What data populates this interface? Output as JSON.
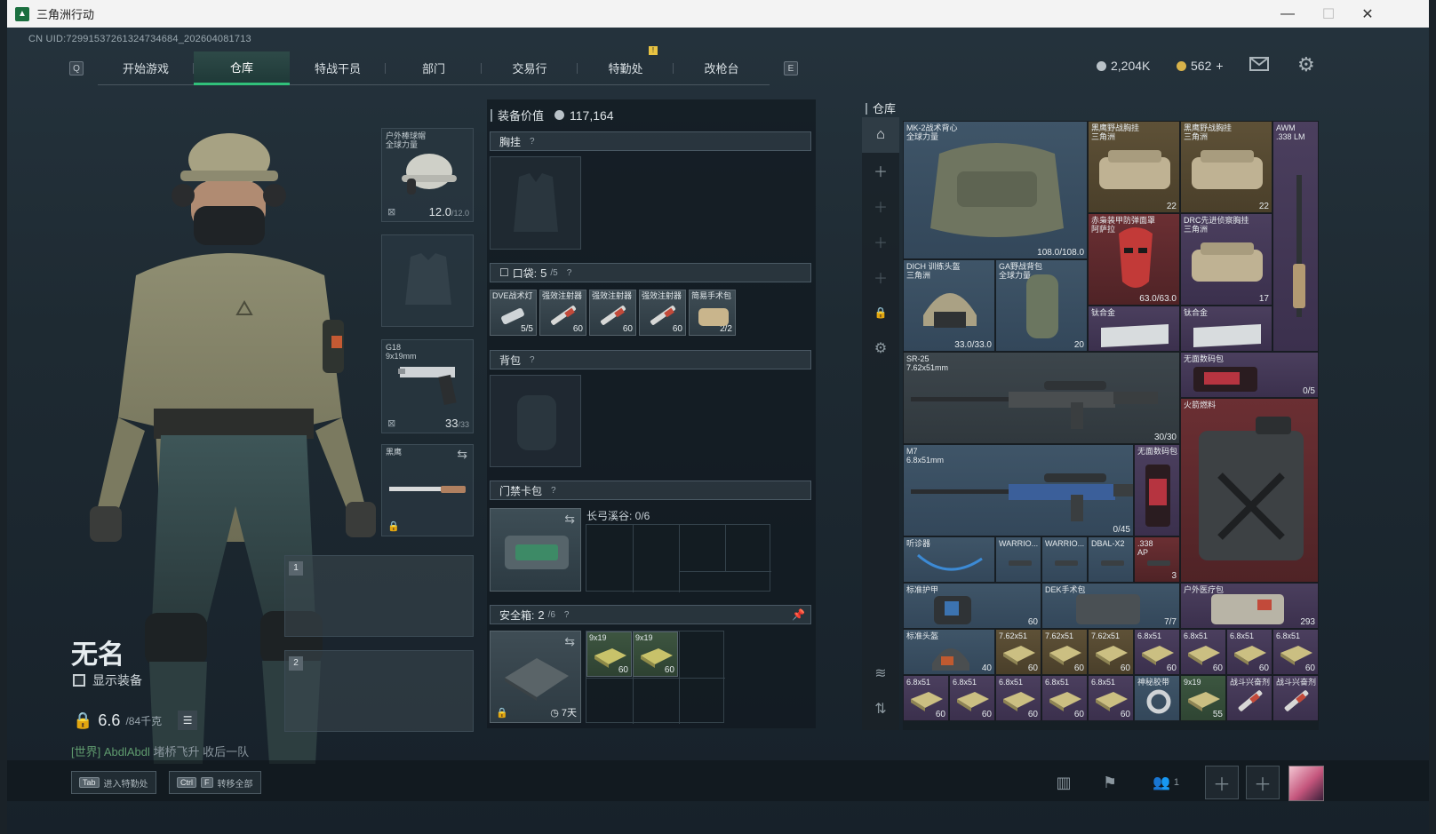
{
  "window": {
    "title": "三角洲行动"
  },
  "uid": "CN UID:7299153726132473468­4_202604081713",
  "nav": {
    "key_left": "Q",
    "key_right": "E",
    "tabs": [
      "开始游戏",
      "仓库",
      "特战干员",
      "部门",
      "交易行",
      "特勤处",
      "改枪台"
    ],
    "selected": "仓库"
  },
  "currency": {
    "silver": "2,204K",
    "gold": "562"
  },
  "player": {
    "name": "无名",
    "show_gear_label": "显示装备",
    "weight": "6.6",
    "weight_max": "/84千克",
    "chat_channel": "[世界] AbdlAbdl",
    "chat_text": "堵桥飞升 收后一队"
  },
  "loadout": {
    "helmet": {
      "label": "户外棒球帽",
      "sub": "全球力量",
      "value": "12.0",
      "max": "/12.0"
    },
    "pistol": {
      "label": "G18",
      "sub": "9x19mm",
      "value": "33",
      "max": "/33"
    },
    "melee": {
      "label": "黑鹰"
    },
    "slot1": "1",
    "slot2": "2"
  },
  "equipment": {
    "value_label": "装备价值",
    "value": "117,164",
    "chest": "胸挂",
    "pockets_label": "口袋:",
    "pockets_count": "5",
    "pockets_max": "/5",
    "pocket_items": [
      {
        "label": "DVE战术灯",
        "cnt": "5/5"
      },
      {
        "label": "强效注射器",
        "cnt": "60"
      },
      {
        "label": "强效注射器",
        "cnt": "60"
      },
      {
        "label": "强效注射器",
        "cnt": "60"
      },
      {
        "label": "简易手术包",
        "cnt": "2/2"
      }
    ],
    "backpack": "背包",
    "keycard": "门禁卡包",
    "keycard_map": "长弓溪谷: 0/6",
    "safebox_label": "安全箱:",
    "safebox_count": "2",
    "safebox_max": "/6",
    "safebox_time": "7天",
    "safebox_items": [
      {
        "label": "9x19",
        "cnt": "60"
      },
      {
        "label": "9x19",
        "cnt": "60"
      }
    ]
  },
  "warehouse": {
    "title": "仓库",
    "items": {
      "vest": {
        "label": "MK-2战术背心",
        "sub": "全球力量",
        "cnt": "108.0/108.0"
      },
      "rig1": {
        "label": "黑鹰野战胸挂",
        "sub": "三角洲",
        "cnt": "22"
      },
      "rig2": {
        "label": "黑鹰野战胸挂",
        "sub": "三角洲",
        "cnt": "22"
      },
      "awm": {
        "label": "AWM",
        "sub": ".338 LM"
      },
      "mask": {
        "label": "赤枭装甲防弹面罩",
        "sub": "阿萨拉",
        "cnt": "63.0/63.0"
      },
      "drc": {
        "label": "DRC先进侦察胸挂",
        "sub": "三角洲",
        "cnt": "17"
      },
      "dich": {
        "label": "DICH 训练头盔",
        "sub": "三角洲",
        "cnt": "33.0/33.0"
      },
      "ga": {
        "label": "GA野战背包",
        "sub": "全球力量",
        "cnt": "20"
      },
      "ingot1": {
        "label": "钛合金"
      },
      "ingot2": {
        "label": "钛合金"
      },
      "sr25": {
        "label": "SR-25",
        "sub": "7.62x51mm",
        "cnt": "30/30"
      },
      "drive1": {
        "label": "无面数码包",
        "cnt": "0/5"
      },
      "fuel": {
        "label": "火箭燃料"
      },
      "m7": {
        "label": "M7",
        "sub": "6.8x51mm",
        "cnt": "0/45"
      },
      "drive2": {
        "label": "无面数码包"
      },
      "steth": {
        "label": "听诊器"
      },
      "w1": {
        "label": "WARRIO..."
      },
      "w2": {
        "label": "WARRIO..."
      },
      "dbal": {
        "label": "DBAL-X2"
      },
      "ap338": {
        "label": ".338",
        "sub": "AP",
        "cnt": "3"
      },
      "armor": {
        "label": "标准护甲",
        "cnt": "60"
      },
      "dek": {
        "label": "DEK手术包",
        "cnt": "7/7"
      },
      "medkit": {
        "label": "户外医疗包",
        "cnt": "293"
      },
      "helm2": {
        "label": "标准头盔",
        "cnt": "40"
      },
      "ammo_row1": [
        {
          "label": "7.62x51",
          "cnt": "60"
        },
        {
          "label": "7.62x51",
          "cnt": "60"
        },
        {
          "label": "7.62x51",
          "cnt": "60"
        },
        {
          "label": "6.8x51",
          "cnt": "60"
        },
        {
          "label": "6.8x51",
          "cnt": "60"
        },
        {
          "label": "6.8x51",
          "cnt": "60"
        },
        {
          "label": "6.8x51",
          "cnt": "60"
        }
      ],
      "ammo_row2": [
        {
          "label": "6.8x51",
          "cnt": "60"
        },
        {
          "label": "6.8x51",
          "cnt": "60"
        },
        {
          "label": "6.8x51",
          "cnt": "60"
        },
        {
          "label": "6.8x51",
          "cnt": "60"
        },
        {
          "label": "6.8x51",
          "cnt": "60"
        },
        {
          "label": "神秘胶带",
          "cnt": ""
        },
        {
          "label": "9x19",
          "cnt": "55"
        },
        {
          "label": "战斗兴奋剂",
          "cnt": ""
        },
        {
          "label": "战斗兴奋剂",
          "cnt": ""
        }
      ],
      "bottom_label": "标准头盔"
    }
  },
  "bottom": {
    "tab_key": "Tab",
    "tab_label": "进入特勤处",
    "ctrl_key": "Ctrl",
    "f_key": "F",
    "transfer_label": "转移全部",
    "squad_count": "1"
  },
  "colors": {
    "accent": "#31c07a",
    "background": "#1e2a32"
  }
}
